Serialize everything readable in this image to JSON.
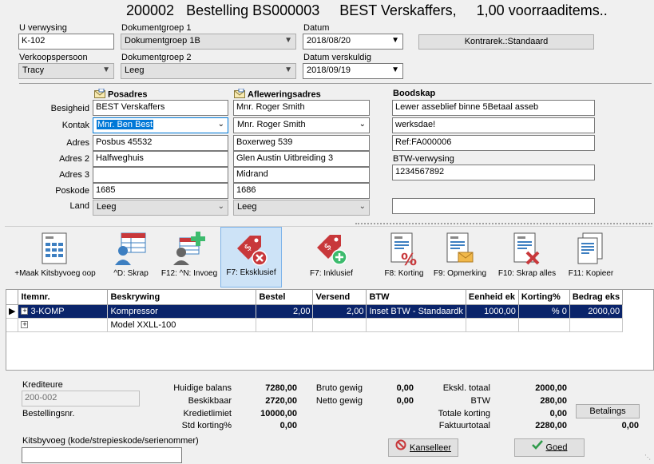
{
  "title": {
    "number": "200002",
    "order": "Bestelling BS000003",
    "supplier": "BEST Verskaffers,",
    "stock": "1,00 voorraaditems.."
  },
  "header": {
    "u_verwysing_label": "U verwysing",
    "u_verwysing_value": "K-102",
    "dokumentgroep1_label": "Dokumentgroep 1",
    "dokumentgroep1_value": "Dokumentgroep 1B",
    "datum_label": "Datum",
    "datum_value": "2018/08/20",
    "kontrarek_button": "Kontrarek.:Standaard",
    "verkoopspersoon_label": "Verkoopspersoon",
    "verkoopspersoon_value": "Tracy",
    "dokumentgroep2_label": "Dokumentgroep 2",
    "dokumentgroep2_value": "Leeg",
    "datum_verskuldig_label": "Datum verskuldig",
    "datum_verskuldig_value": "2018/09/19"
  },
  "address": {
    "posadres_head": "Posadres",
    "aflewering_head": "Afleweringsadres",
    "boodskap_head": "Boodskap",
    "labels": {
      "besigheid": "Besigheid",
      "kontak": "Kontak",
      "adres": "Adres",
      "adres2": "Adres 2",
      "adres3": "Adres 3",
      "poskode": "Poskode",
      "land": "Land"
    },
    "post": {
      "besigheid": "BEST Verskaffers",
      "kontak": "Mnr. Ben Best",
      "adres": "Posbus 45532",
      "adres2": "Halfweghuis",
      "adres3": "",
      "poskode": "1685",
      "land": "Leeg"
    },
    "delivery": {
      "besigheid": "Mnr. Roger Smith",
      "kontak": "Mnr. Roger Smith",
      "adres": "Boxerweg 539",
      "adres2": "Glen Austin Uitbreiding 3",
      "adres3": "Midrand",
      "poskode": "1686",
      "land": "Leeg"
    },
    "message": {
      "line1": "Lewer asseblief binne 5Betaal asseb",
      "line2": "werksdae!",
      "line3": "Ref:FA000006",
      "btw_label": "BTW-verwysing",
      "btw_value": "1234567892",
      "extra": ""
    }
  },
  "toolbar": {
    "kit": "+Maak Kitsbyvoeg oop",
    "delete": "^D: Skrap",
    "insert": "F12: ^N: Invoeg",
    "exclusive": "F7: Eksklusief",
    "inclusive": "F7: Inklusief",
    "discount": "F8: Korting",
    "note": "F9: Opmerking",
    "delete_all": "F10: Skrap alles",
    "copy": "F11: Kopieer"
  },
  "grid": {
    "columns": [
      "Itemnr.",
      "Beskrywing",
      "Bestel",
      "Versend",
      "BTW",
      "Eenheid ek",
      "Korting%",
      "Bedrag eks"
    ],
    "rows": [
      [
        "3-KOMP",
        "Kompressor",
        "2,00",
        "2,00",
        "Inset BTW - Standaardk",
        "1000,00",
        "% 0",
        "2000,00"
      ],
      [
        "",
        "Model XXLL-100",
        "",
        "",
        "",
        "",
        "",
        ""
      ]
    ]
  },
  "footer": {
    "krediteure_label": "Krediteure",
    "krediteure_value": "200-002",
    "bestellingsnr_label": "Bestellingsnr.",
    "kitsbyvoeg_label": "Kitsbyvoeg (kode/strepieskode/serienommer)",
    "kitsbyvoeg_value": "",
    "huidige_balans_label": "Huidige balans",
    "huidige_balans": "7280,00",
    "beskikbaar_label": "Beskikbaar",
    "beskikbaar": "2720,00",
    "kredietlimiet_label": "Kredietlimiet",
    "kredietlimiet": "10000,00",
    "std_korting_label": "Std korting%",
    "std_korting": "0,00",
    "bruto_label": "Bruto gewig",
    "bruto": "0,00",
    "netto_label": "Netto gewig",
    "netto": "0,00",
    "ekskl_label": "Ekskl. totaal",
    "ekskl": "2000,00",
    "btw_label": "BTW",
    "btw": "280,00",
    "totale_korting_label": "Totale korting",
    "totale_korting": "0,00",
    "faktuurtotaal_label": "Faktuurtotaal",
    "faktuurtotaal": "2280,00",
    "betalings_button": "Betalings",
    "betalings_value": "0,00",
    "kanselleer_button": "Kanselleer",
    "goed_button": "Goed"
  },
  "colors": {
    "selection": "#0a246a",
    "active_tool": "#cde3f7",
    "accent_red": "#c8383b",
    "accent_green": "#3dbb6d"
  }
}
